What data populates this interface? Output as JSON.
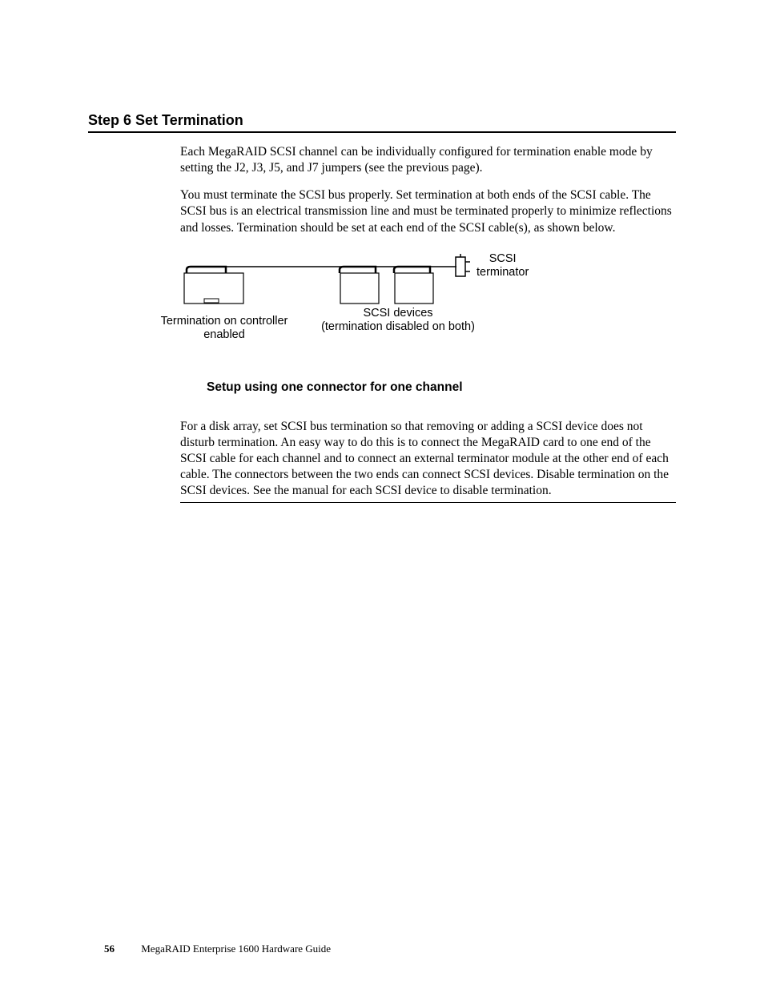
{
  "heading": "Step 6 Set Termination",
  "para1": "Each MegaRAID SCSI channel can be individually configured for termination enable mode by setting the J2, J3, J5, and J7 jumpers (see the previous page).",
  "para2": "You must terminate the SCSI bus properly. Set termination at both ends of the SCSI cable. The SCSI bus is an electrical transmission line and must be terminated properly to minimize reflections and losses. Termination should be set at each end of the SCSI cable(s), as shown below.",
  "diagram": {
    "label_terminator_1": "SCSI",
    "label_terminator_2": "terminator",
    "label_controller_1": "Termination on controller",
    "label_controller_2": "enabled",
    "label_devices_1": "SCSI devices",
    "label_devices_2": "(termination disabled on both)"
  },
  "caption": "Setup using one connector for one channel",
  "para3": "For a disk array, set SCSI bus termination so that removing or adding a SCSI device does not disturb termination. An easy way to do this is to connect the MegaRAID card to one end of the SCSI cable for each channel and to connect an external terminator module at the other end of each cable. The connectors between the two ends can connect SCSI devices. Disable termination on the SCSI devices. See the manual for each SCSI device to disable termination.",
  "footer": {
    "page": "56",
    "title": "MegaRAID Enterprise 1600 Hardware Guide"
  }
}
